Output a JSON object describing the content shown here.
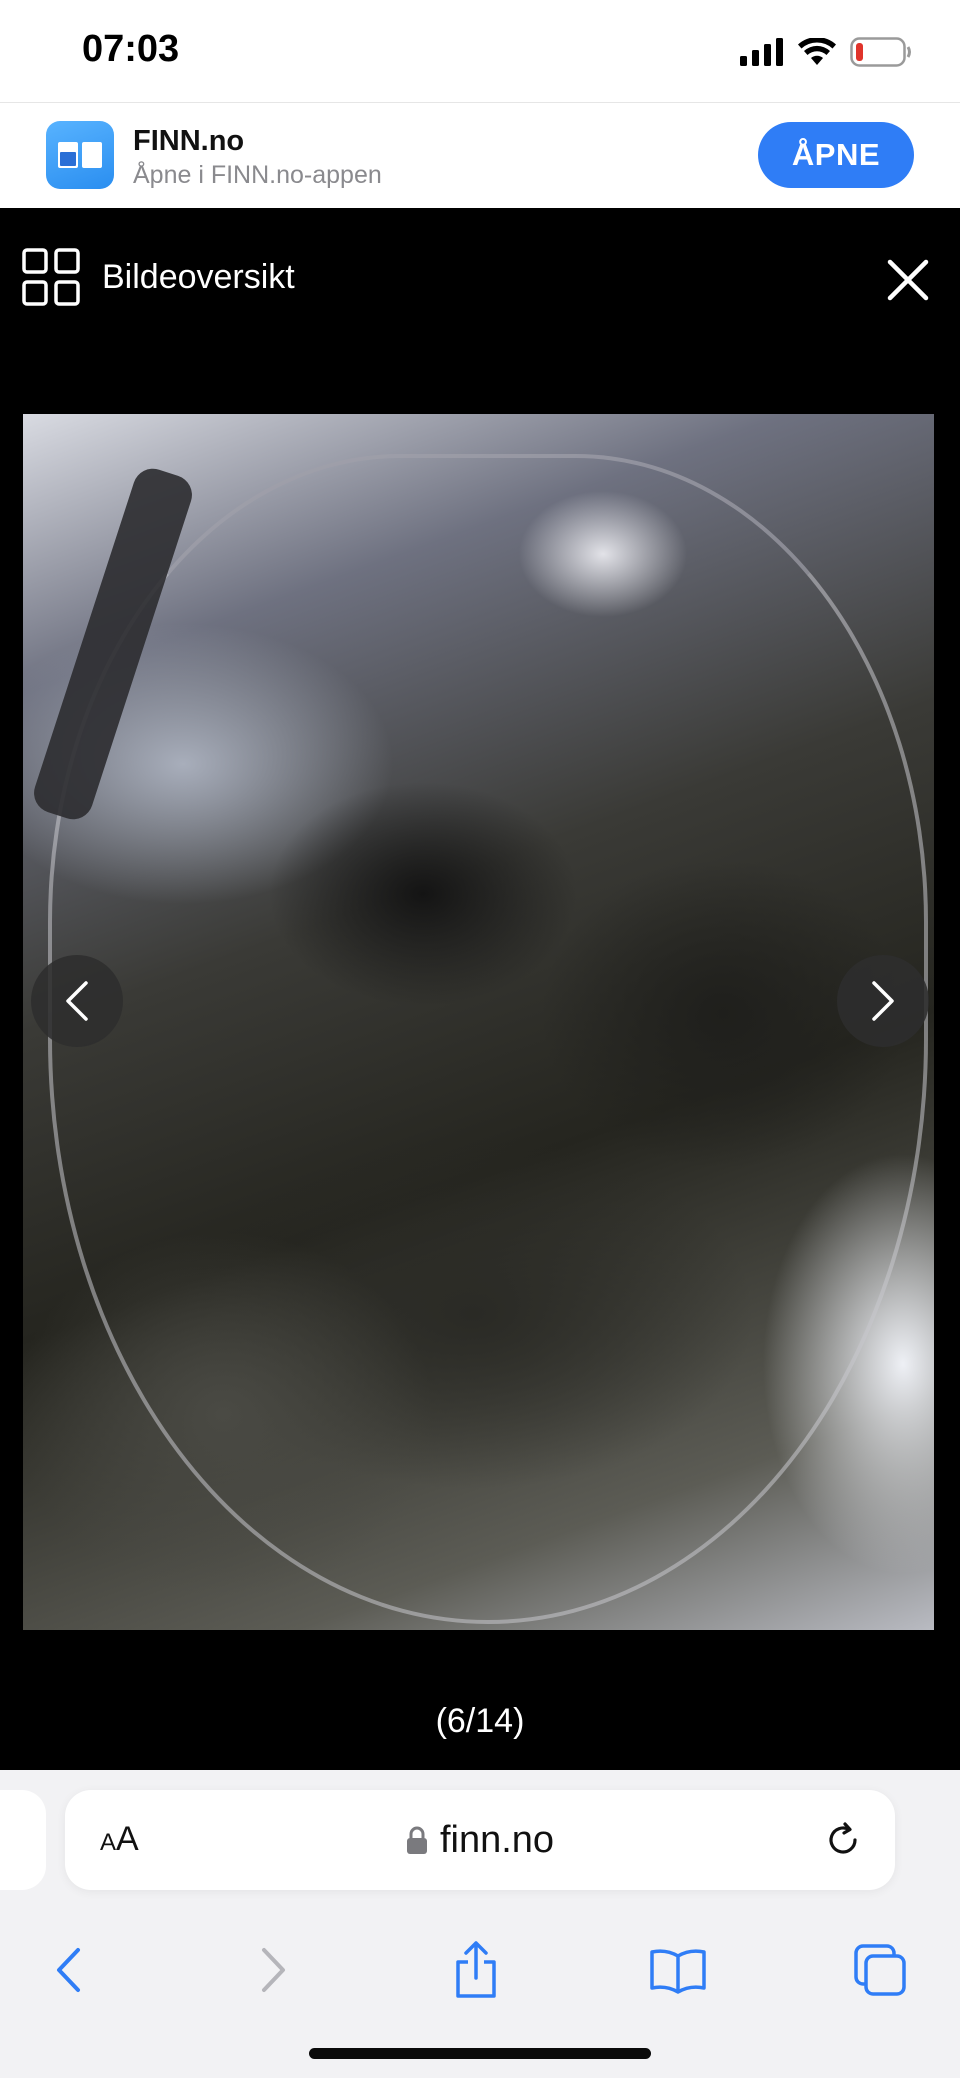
{
  "status_bar": {
    "time": "07:03",
    "icons": [
      "signal-icon",
      "wifi-icon",
      "battery-icon"
    ],
    "battery_color": "#e0342b"
  },
  "app_banner": {
    "title": "FINN.no",
    "subtitle": "Åpne i FINN.no-appen",
    "open_label": "ÅPNE",
    "accent": "#2f7df6"
  },
  "gallery": {
    "overview_label": "Bildeoversikt",
    "counter": "(6/14)",
    "image_alt": "Innsiden av en svart veske",
    "prev_icon": "chevron-left-icon",
    "next_icon": "chevron-right-icon",
    "close_icon": "close-icon"
  },
  "browser": {
    "aa_label_small": "A",
    "aa_label_large": "A",
    "url": "finn.no",
    "toolbar_icons": [
      "back-icon",
      "forward-icon",
      "share-icon",
      "bookmarks-icon",
      "tabs-icon"
    ],
    "accent": "#2f7df6"
  }
}
